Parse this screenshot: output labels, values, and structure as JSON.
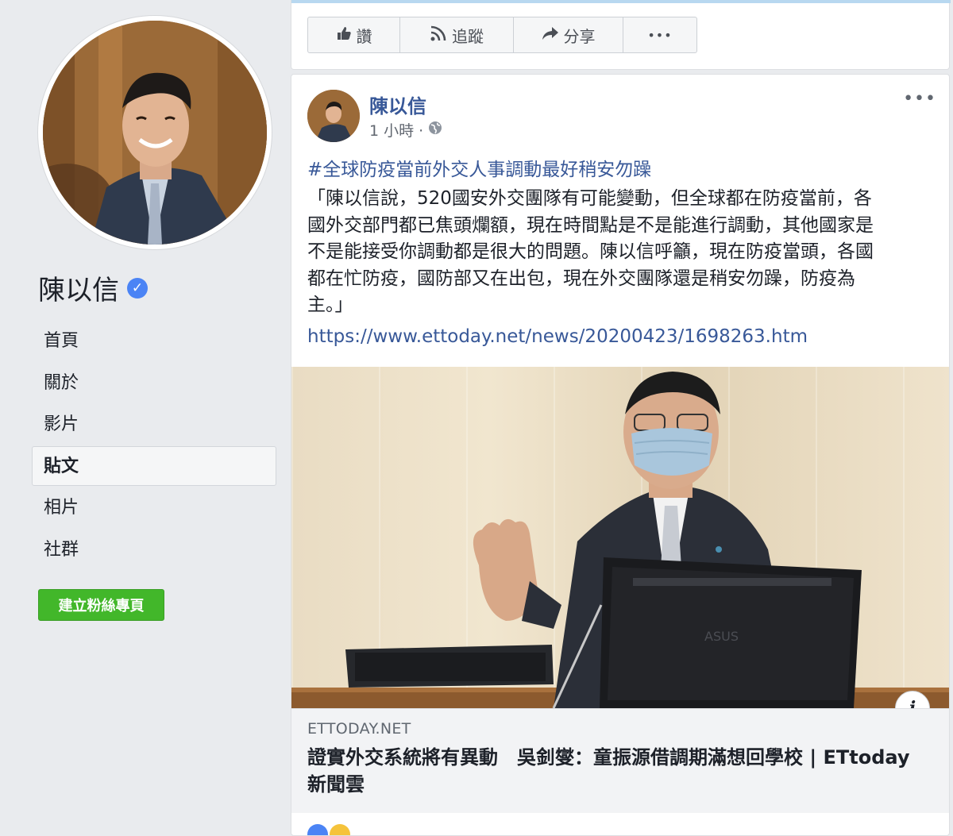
{
  "sidebar": {
    "page_name": "陳以信",
    "verified_mark": "✓",
    "nav": [
      {
        "label": "首頁",
        "active": false
      },
      {
        "label": "關於",
        "active": false
      },
      {
        "label": "影片",
        "active": false
      },
      {
        "label": "貼文",
        "active": true
      },
      {
        "label": "相片",
        "active": false
      },
      {
        "label": "社群",
        "active": false
      }
    ],
    "create_page_button": "建立粉絲專頁"
  },
  "actions": {
    "like": {
      "label": "讚",
      "icon": "thumbs-up-icon"
    },
    "follow": {
      "label": "追蹤",
      "icon": "rss-icon"
    },
    "share": {
      "label": "分享",
      "icon": "share-arrow-icon"
    },
    "more": {
      "label": "•••",
      "icon": "more-dots-icon"
    }
  },
  "post": {
    "author": "陳以信",
    "time": "1 小時 ·",
    "privacy_icon": "globe-icon",
    "more": "•••",
    "hashtag": "#全球防疫當前外交人事調動最好稍安勿躁",
    "body_lines": [
      "「陳以信說，520國安外交團隊有可能變動，但全球都在防疫當前，各",
      "國外交部門都已焦頭爛額，現在時間點是不是能進行調動，其他國家是",
      "不是能接受你調動都是很大的問題。陳以信呼籲，現在防疫當頭，各國",
      "都在忙防疫，國防部又在出包，現在外交團隊還是稍安勿躁，防疫為",
      "主。」"
    ],
    "link": "https://www.ettoday.net/news/20200423/1698263.htm",
    "link_preview": {
      "info_label": "i",
      "domain": "ETTODAY.NET",
      "title": "證實外交系統將有異動　吳釗燮：童振源借調期滿想回學校 | ETtoday新聞雲"
    }
  },
  "colors": {
    "link_blue": "#385898",
    "create_green": "#42b72a",
    "verified_blue": "#4b84f5",
    "background": "#e9ebee"
  }
}
